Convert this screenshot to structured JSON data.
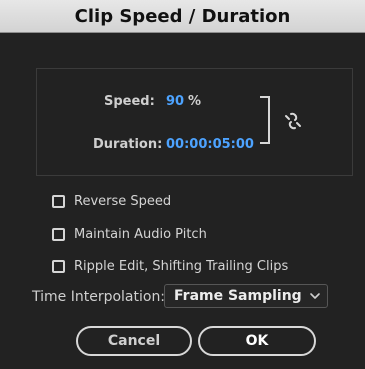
{
  "dialog": {
    "title": "Clip Speed / Duration"
  },
  "speed": {
    "label": "Speed:",
    "value": "90",
    "unit": "%"
  },
  "duration": {
    "label": "Duration:",
    "value": "00:00:05:00"
  },
  "options": [
    {
      "label": "Reverse Speed",
      "checked": false
    },
    {
      "label": "Maintain Audio Pitch",
      "checked": false
    },
    {
      "label": "Ripple Edit, Shifting Trailing Clips",
      "checked": false
    }
  ],
  "interpolation": {
    "label": "Time Interpolation:",
    "selected": "Frame Sampling"
  },
  "buttons": {
    "cancel": "Cancel",
    "ok": "OK"
  },
  "icons": {
    "link": "broken-chain-link-icon",
    "dropdown": "chevron-down-icon"
  },
  "colors": {
    "background": "#222222",
    "titlebar": "#dcdcdc",
    "accent_value": "#4da3ff",
    "text": "#cfcfcf"
  }
}
